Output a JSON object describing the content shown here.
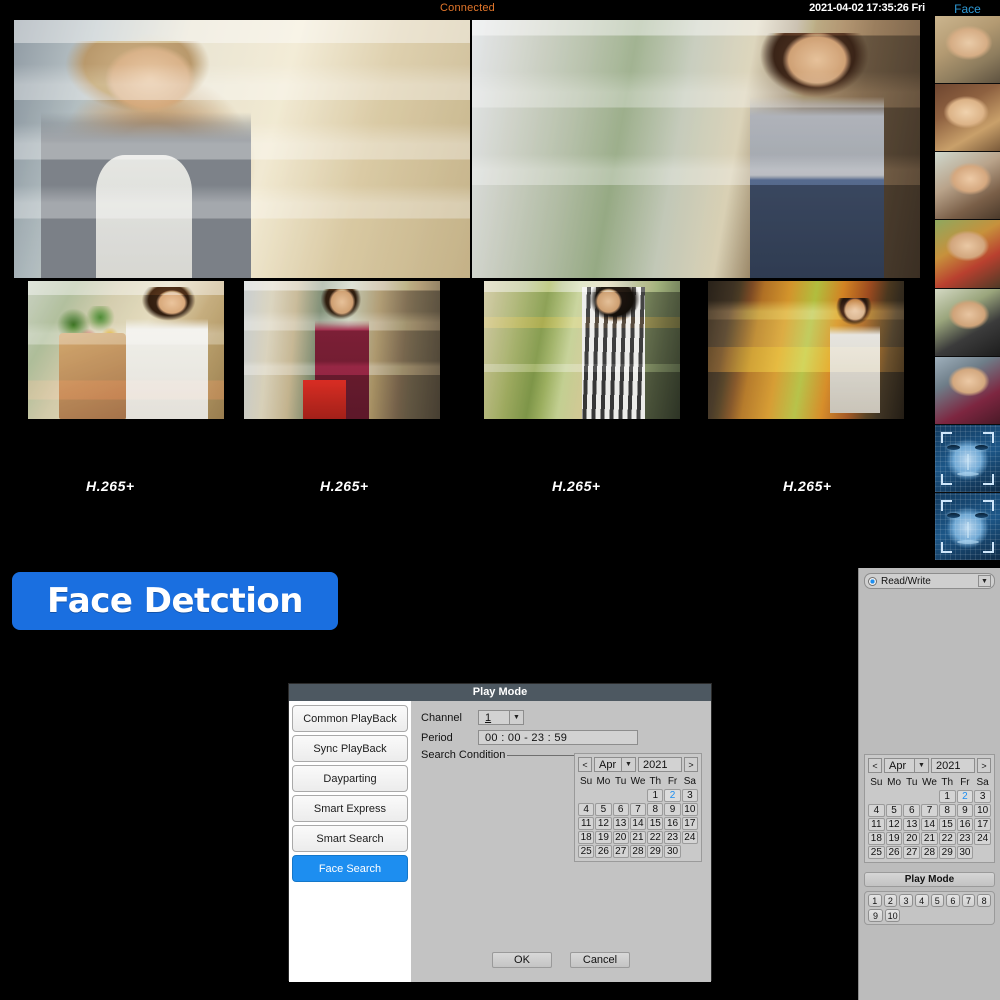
{
  "live": {
    "status": "Connected",
    "datetime": "2021-04-02 17:35:26 Fri",
    "face_tab_label": "Face",
    "main_views": [
      {
        "name": "channel-1",
        "caption": ""
      },
      {
        "name": "channel-2",
        "caption": ""
      }
    ],
    "thumbnails": [
      {
        "codec": "H.265+"
      },
      {
        "codec": "H.265+"
      },
      {
        "codec": "H.265+"
      },
      {
        "codec": "H.265+"
      }
    ],
    "face_captures": [
      "face-capture-1",
      "face-capture-2",
      "face-capture-3",
      "face-capture-4",
      "face-capture-5",
      "face-capture-6",
      "face-mesh-1",
      "face-mesh-2"
    ],
    "colors": {
      "connected": "#e2762b",
      "face_tab": "#2f9ad6",
      "background": "#000000"
    }
  },
  "banner": {
    "text": "Face Detction",
    "background": "#1a6fe0",
    "text_color": "#ffffff"
  },
  "dialog": {
    "title": "Play Mode",
    "title_bg": "#4d5861",
    "accent": "#1d8ef0",
    "modes": [
      {
        "label": "Common PlayBack",
        "active": false
      },
      {
        "label": "Sync PlayBack",
        "active": false
      },
      {
        "label": "Dayparting",
        "active": false
      },
      {
        "label": "Smart Express",
        "active": false
      },
      {
        "label": "Smart Search",
        "active": false
      },
      {
        "label": "Face Search",
        "active": true
      }
    ],
    "fields": {
      "channel_label": "Channel",
      "channel_value": "1",
      "period_label": "Period",
      "period_value": "00 : 00   -   23 : 59",
      "search_condition_label": "Search Condition"
    },
    "calendar": {
      "prev": "<",
      "next": ">",
      "month": "Apr",
      "year": "2021",
      "dow": [
        "Su",
        "Mo",
        "Tu",
        "We",
        "Th",
        "Fr",
        "Sa"
      ],
      "lead_blanks": 4,
      "days": [
        1,
        2,
        3,
        4,
        5,
        6,
        7,
        8,
        9,
        10,
        11,
        12,
        13,
        14,
        15,
        16,
        17,
        18,
        19,
        20,
        21,
        22,
        23,
        24,
        25,
        26,
        27,
        28,
        29,
        30
      ],
      "selected_day": 2
    },
    "buttons": {
      "ok": "OK",
      "cancel": "Cancel"
    }
  },
  "side_panel": {
    "disk_mode": "Read/Write",
    "calendar": {
      "prev": "<",
      "next": ">",
      "month": "Apr",
      "year": "2021",
      "dow": [
        "Su",
        "Mo",
        "Tu",
        "We",
        "Th",
        "Fr",
        "Sa"
      ],
      "lead_blanks": 4,
      "days": [
        1,
        2,
        3,
        4,
        5,
        6,
        7,
        8,
        9,
        10,
        11,
        12,
        13,
        14,
        15,
        16,
        17,
        18,
        19,
        20,
        21,
        22,
        23,
        24,
        25,
        26,
        27,
        28,
        29,
        30
      ],
      "selected_day": 2
    },
    "play_mode_label": "Play Mode",
    "channels": [
      "1",
      "2",
      "3",
      "4",
      "5",
      "6",
      "7",
      "8"
    ],
    "channels_row2": [
      "9",
      "10"
    ]
  }
}
